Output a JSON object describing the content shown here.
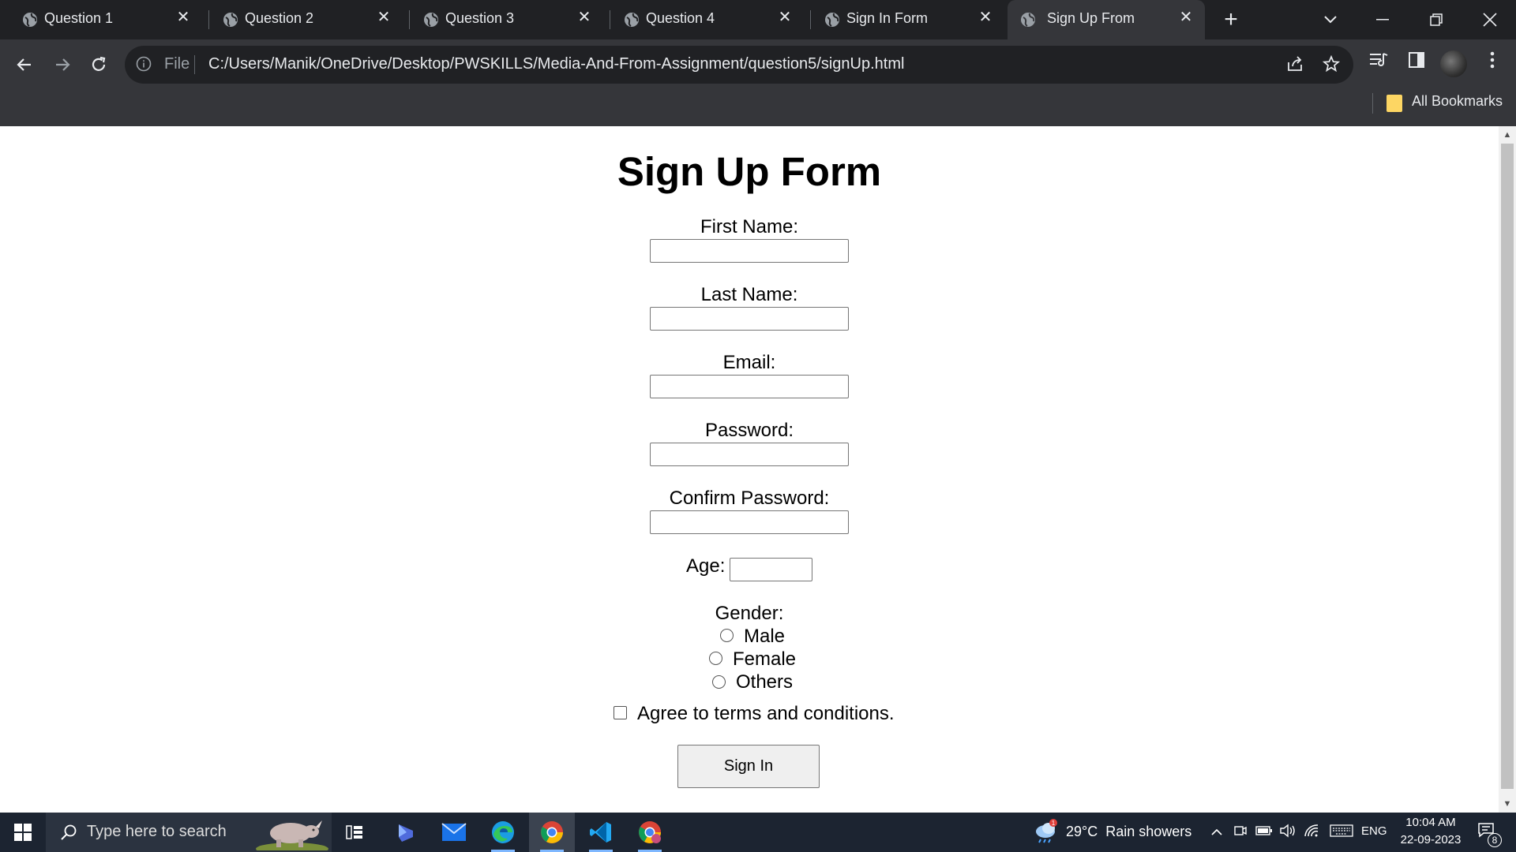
{
  "browser": {
    "tabs": [
      {
        "label": "Question 1",
        "active": false
      },
      {
        "label": "Question 2",
        "active": false
      },
      {
        "label": "Question 3",
        "active": false
      },
      {
        "label": "Question 4",
        "active": false
      },
      {
        "label": "Sign In Form",
        "active": false
      },
      {
        "label": "Sign Up From",
        "active": true
      }
    ],
    "new_tab_label": "+",
    "address": {
      "scheme_label": "File",
      "url": "C:/Users/Manik/OneDrive/Desktop/PWSKILLS/Media-And-From-Assignment/question5/signUp.html"
    },
    "bookmarks_bar": {
      "all_bookmarks_label": "All Bookmarks"
    }
  },
  "page": {
    "title": "Sign Up Form",
    "fields": {
      "first_name_label": "First Name:",
      "last_name_label": "Last Name:",
      "email_label": "Email:",
      "password_label": "Password:",
      "confirm_password_label": "Confirm Password:",
      "age_label": "Age:",
      "first_name_value": "",
      "last_name_value": "",
      "email_value": "",
      "password_value": "",
      "confirm_password_value": "",
      "age_value": ""
    },
    "gender": {
      "label": "Gender:",
      "options": [
        "Male",
        "Female",
        "Others"
      ],
      "selected": null
    },
    "terms": {
      "label": "Agree to terms and conditions.",
      "checked": false
    },
    "submit_label": "Sign In"
  },
  "taskbar": {
    "search_placeholder": "Type here to search",
    "weather": {
      "temperature": "29°C",
      "condition": "Rain showers",
      "alert_count": "1"
    },
    "language": "ENG",
    "time": "10:04 AM",
    "date": "22-09-2023",
    "notification_count": "8",
    "pinned_apps": [
      "task-view",
      "copilot",
      "mail",
      "edge",
      "chrome",
      "vscode",
      "chrome-profile"
    ]
  },
  "colors": {
    "tabstrip_bg": "#202124",
    "toolbar_bg": "#35363a",
    "taskbar_bg": "#1c2431",
    "page_bg": "#ffffff"
  }
}
